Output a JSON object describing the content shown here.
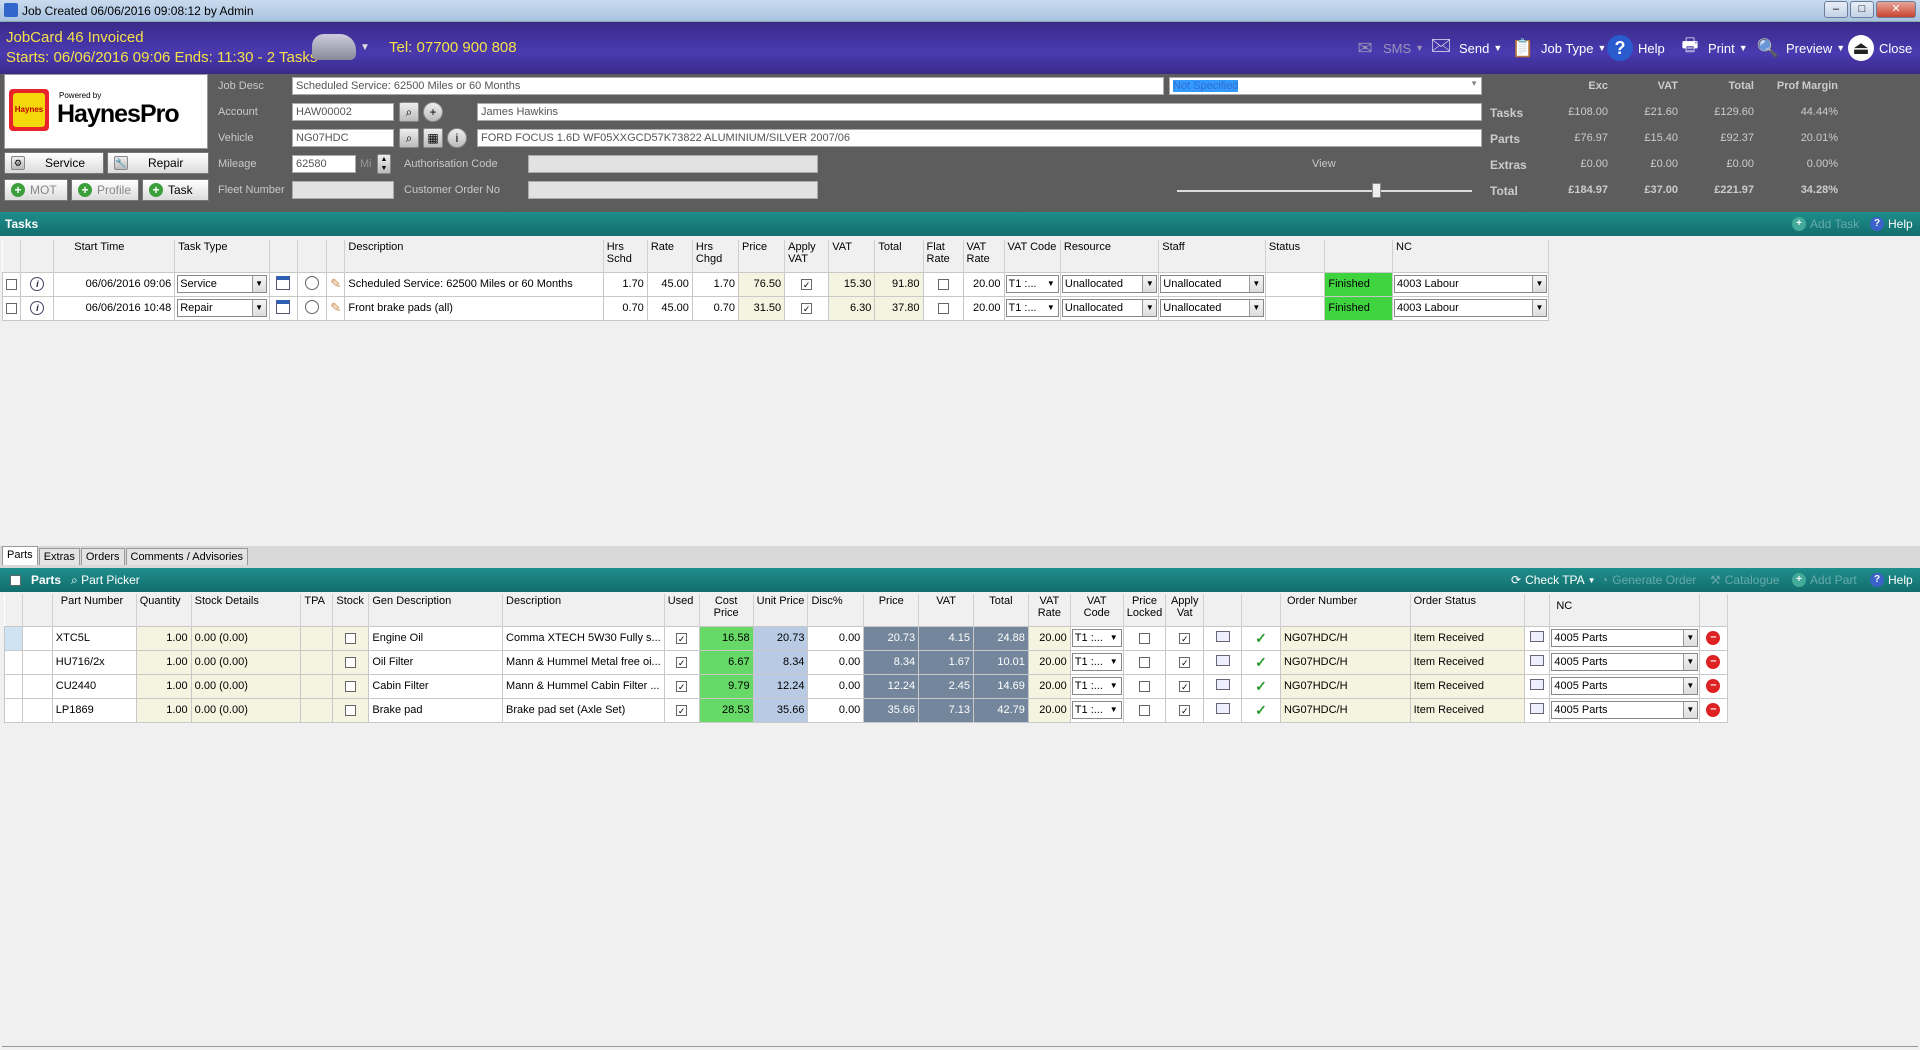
{
  "window": {
    "title": "Job Created 06/06/2016 09:08:12 by Admin"
  },
  "header": {
    "line1": "JobCard 46 Invoiced",
    "line2": "Starts: 06/06/2016 09:06 Ends: 11:30 - 2 Tasks",
    "tel": "Tel: 07700 900 808",
    "toolbar": {
      "sms": "SMS",
      "send": "Send",
      "job_type": "Job Type",
      "help": "Help",
      "print": "Print",
      "preview": "Preview",
      "close": "Close"
    }
  },
  "logo": {
    "powered": "Powered by",
    "name": "HaynesPro",
    "badge": "Haynes"
  },
  "buttons": {
    "service": "Service",
    "repair": "Repair",
    "mot": "MOT",
    "profile": "Profile",
    "task": "Task"
  },
  "fields": {
    "job_desc_label": "Job Desc",
    "job_desc": "Scheduled Service: 62500 Miles or 60 Months",
    "job_status": "Not Specified",
    "account_label": "Account",
    "account": "HAW00002",
    "customer_name": "James Hawkins",
    "vehicle_label": "Vehicle",
    "vehicle": "NG07HDC",
    "vehicle_desc": "FORD FOCUS 1.6D WF05XXGCD57K73822 ALUMINIUM/SILVER 2007/06",
    "mileage_label": "Mileage",
    "mileage": "62580",
    "mileage_unit": "Mi",
    "auth_label": "Authorisation Code",
    "fleet_label": "Fleet Number",
    "cust_order_label": "Customer Order No",
    "view_label": "View"
  },
  "summary": {
    "headers": [
      "Exc",
      "VAT",
      "Total",
      "Prof Margin"
    ],
    "rows": [
      {
        "label": "Tasks",
        "values": [
          "£108.00",
          "£21.60",
          "£129.60",
          "44.44%"
        ]
      },
      {
        "label": "Parts",
        "values": [
          "£76.97",
          "£15.40",
          "£92.37",
          "20.01%"
        ]
      },
      {
        "label": "Extras",
        "values": [
          "£0.00",
          "£0.00",
          "£0.00",
          "0.00%"
        ]
      },
      {
        "label": "Total",
        "values": [
          "£184.97",
          "£37.00",
          "£221.97",
          "34.28%"
        ]
      }
    ]
  },
  "tasks": {
    "title": "Tasks",
    "add_task": "Add Task",
    "help": "Help",
    "headers": [
      "Start Time",
      "Task Type",
      "Description",
      "Hrs Schd",
      "Rate",
      "Hrs Chgd",
      "Price",
      "Apply VAT",
      "VAT",
      "Total",
      "Flat Rate",
      "VAT Rate",
      "VAT Code",
      "Resource",
      "Staff",
      "Status",
      "NC"
    ],
    "rows": [
      {
        "start": "06/06/2016 09:06",
        "type": "Service",
        "desc": "Scheduled Service: 62500 Miles or 60 Months",
        "hrs_schd": "1.70",
        "rate": "45.00",
        "hrs_chgd": "1.70",
        "price": "76.50",
        "vat": "15.30",
        "total": "91.80",
        "vat_rate": "20.00",
        "vat_code": "T1 :...",
        "resource": "Unallocated",
        "staff": "Unallocated",
        "status": "Finished",
        "nc": "4003 Labour"
      },
      {
        "start": "06/06/2016 10:48",
        "type": "Repair",
        "desc": "Front brake pads (all)",
        "hrs_schd": "0.70",
        "rate": "45.00",
        "hrs_chgd": "0.70",
        "price": "31.50",
        "vat": "6.30",
        "total": "37.80",
        "vat_rate": "20.00",
        "vat_code": "T1 :...",
        "resource": "Unallocated",
        "staff": "Unallocated",
        "status": "Finished",
        "nc": "4003 Labour"
      }
    ]
  },
  "bottom_tabs": [
    "Parts",
    "Extras",
    "Orders",
    "Comments / Advisories"
  ],
  "parts": {
    "title": "Parts",
    "picker": "Part Picker",
    "check_tpa": "Check TPA",
    "gen_order": "Generate Order",
    "catalogue": "Catalogue",
    "add_part": "Add Part",
    "help": "Help",
    "headers": [
      "Part Number",
      "Quantity",
      "Stock Details",
      "TPA",
      "Stock",
      "Gen Description",
      "Description",
      "Used",
      "Cost Price",
      "Unit Price",
      "Disc%",
      "Price",
      "VAT",
      "Total",
      "VAT Rate",
      "VAT Code",
      "Price Locked",
      "Apply Vat",
      "Order Number",
      "Order Status",
      "NC"
    ],
    "rows": [
      {
        "pn": "XTC5L",
        "qty": "1.00",
        "stock": "0.00 (0.00)",
        "gen": "Engine Oil",
        "desc": "Comma XTECH 5W30 Fully s...",
        "cost": "16.58",
        "unit": "20.73",
        "disc": "0.00",
        "price": "20.73",
        "vat": "4.15",
        "total": "24.88",
        "vat_rate": "20.00",
        "vat_code": "T1 :...",
        "order": "NG07HDC/H",
        "status": "Item Received",
        "nc": "4005 Parts"
      },
      {
        "pn": "HU716/2x",
        "qty": "1.00",
        "stock": "0.00 (0.00)",
        "gen": "Oil Filter",
        "desc": "Mann & Hummel Metal free oi...",
        "cost": "6.67",
        "unit": "8.34",
        "disc": "0.00",
        "price": "8.34",
        "vat": "1.67",
        "total": "10.01",
        "vat_rate": "20.00",
        "vat_code": "T1 :...",
        "order": "NG07HDC/H",
        "status": "Item Received",
        "nc": "4005 Parts"
      },
      {
        "pn": "CU2440",
        "qty": "1.00",
        "stock": "0.00 (0.00)",
        "gen": "Cabin Filter",
        "desc": "Mann & Hummel Cabin Filter ...",
        "cost": "9.79",
        "unit": "12.24",
        "disc": "0.00",
        "price": "12.24",
        "vat": "2.45",
        "total": "14.69",
        "vat_rate": "20.00",
        "vat_code": "T1 :...",
        "order": "NG07HDC/H",
        "status": "Item Received",
        "nc": "4005 Parts"
      },
      {
        "pn": "LP1869",
        "qty": "1.00",
        "stock": "0.00 (0.00)",
        "gen": "Brake pad",
        "desc": "Brake pad set (Axle Set)",
        "cost": "28.53",
        "unit": "35.66",
        "disc": "0.00",
        "price": "35.66",
        "vat": "7.13",
        "total": "42.79",
        "vat_rate": "20.00",
        "vat_code": "T1 :...",
        "order": "NG07HDC/H",
        "status": "Item Received",
        "nc": "4005 Parts"
      }
    ]
  }
}
